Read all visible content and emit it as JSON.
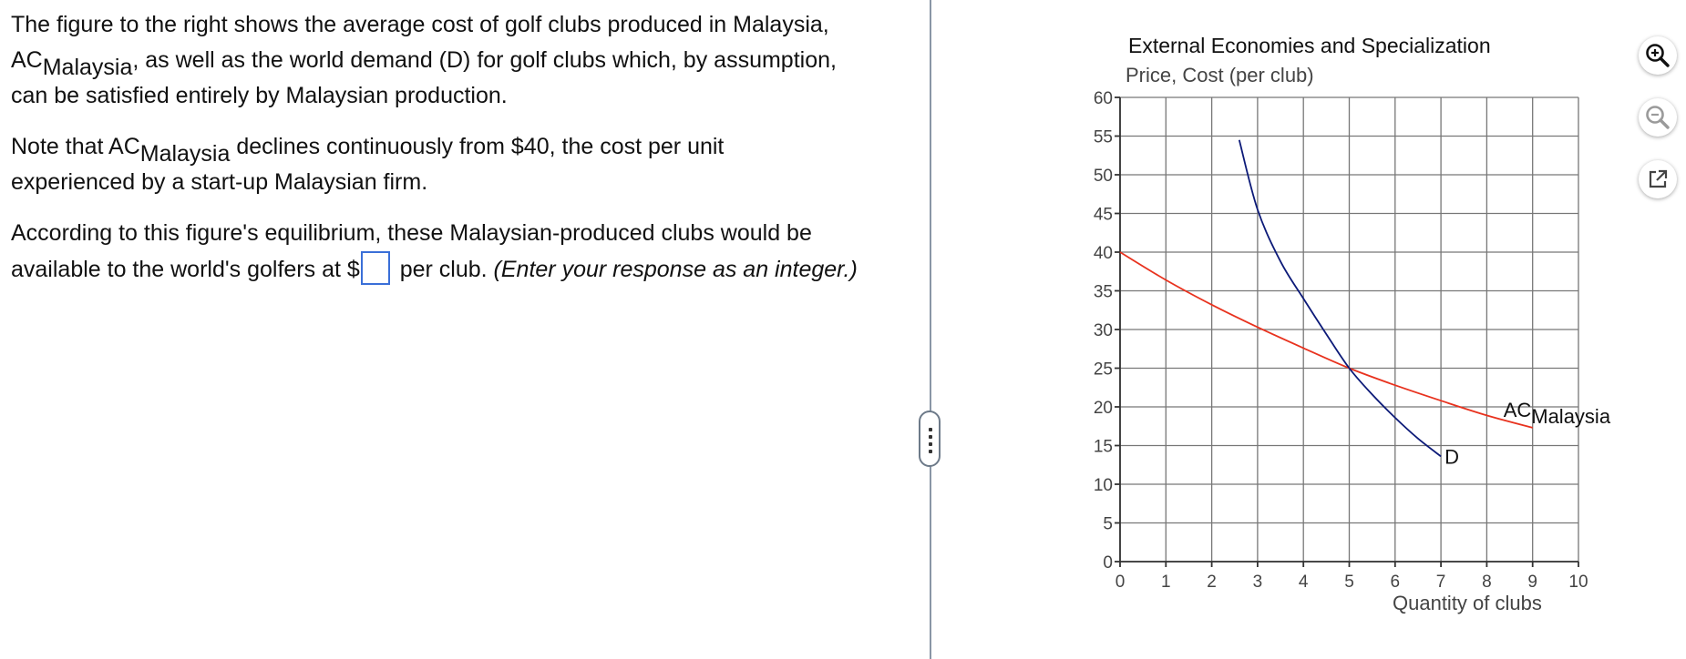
{
  "question": {
    "p1_text": "The figure to the right shows the average cost of golf clubs produced in Malaysia,",
    "p1_ac": "AC",
    "p1_sub": "Malaysia",
    "p1_rest": ", as well as the world demand (D) for golf clubs which, by assumption,",
    "p1_line3": "can be satisfied entirely by Malaysian production.",
    "p2_pre": "Note that AC",
    "p2_sub": "Malaysia",
    "p2_post": " declines continuously from $40, the cost per unit",
    "p2_line2": "experienced by a start-up Malaysian firm.",
    "p3_line1": "According to this figure's equilibrium, these Malaysian-produced clubs would be",
    "p3_pre": "available to the world's golfers at $",
    "p3_post": " per club. ",
    "p3_italic": "(Enter your response as an integer.)"
  },
  "answer": {
    "value": ""
  },
  "chart_data": {
    "type": "line",
    "title": "External Economies and Specialization",
    "ylabel": "Price, Cost (per club)",
    "xlabel": "Quantity of clubs",
    "xlim": [
      0,
      10
    ],
    "ylim": [
      0,
      60
    ],
    "x_ticks": [
      0,
      1,
      2,
      3,
      4,
      5,
      6,
      7,
      8,
      9,
      10
    ],
    "y_ticks": [
      0,
      5,
      10,
      15,
      20,
      25,
      30,
      35,
      40,
      45,
      50,
      55,
      60
    ],
    "grid": true,
    "series": [
      {
        "name": "ACMalaysia",
        "label_main": "AC",
        "label_sub": "Malaysia",
        "color": "#e8321e",
        "points": [
          [
            0,
            40
          ],
          [
            1,
            36.4
          ],
          [
            2,
            33.2
          ],
          [
            3,
            30.3
          ],
          [
            4,
            27.6
          ],
          [
            5,
            25
          ],
          [
            6,
            22.8
          ],
          [
            7,
            20.8
          ],
          [
            8,
            18.9
          ],
          [
            9,
            17.3
          ]
        ]
      },
      {
        "name": "D",
        "label_main": "D",
        "label_sub": "",
        "color": "#0c1a78",
        "points": [
          [
            2.6,
            54.5
          ],
          [
            3,
            45.5
          ],
          [
            3.5,
            38.8
          ],
          [
            4,
            34
          ],
          [
            4.5,
            29.4
          ],
          [
            5,
            25
          ],
          [
            5.5,
            21.6
          ],
          [
            6,
            18.6
          ],
          [
            6.5,
            15.9
          ],
          [
            7,
            13.6
          ]
        ]
      }
    ]
  },
  "tools": {
    "zoom_in_icon": "zoom-in-icon",
    "zoom_out_icon": "zoom-out-icon",
    "open_external_icon": "external-link-icon"
  }
}
